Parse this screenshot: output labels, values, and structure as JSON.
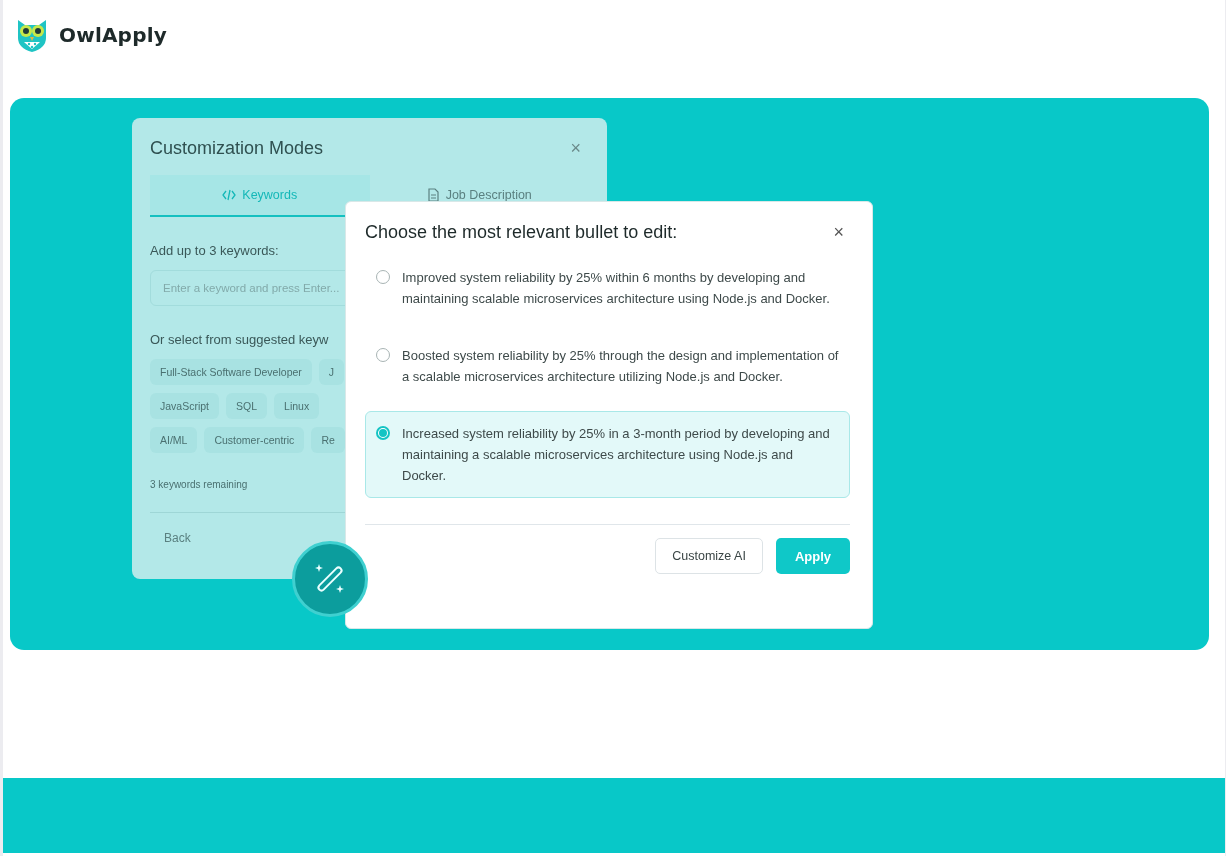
{
  "header": {
    "brand": "OwlApply"
  },
  "customization_dialog": {
    "title": "Customization Modes",
    "close": "×",
    "tabs": [
      {
        "label": "Keywords",
        "selected": true
      },
      {
        "label": "Job Description",
        "selected": false
      }
    ],
    "keywords_label": "Add up to 3 keywords:",
    "keyword_input": {
      "placeholder": "Enter a keyword and press Enter..."
    },
    "suggested_label": "Or select from suggested keyw",
    "suggested_keywords": [
      [
        "Full-Stack Software Developer",
        "J"
      ],
      [
        "JavaScript",
        "SQL",
        "Linux"
      ],
      [
        "AI/ML",
        "Customer-centric",
        "Re"
      ]
    ],
    "remaining": "3 keywords remaining",
    "back": "Back"
  },
  "bullet_dialog": {
    "title": "Choose the most relevant bullet to edit:",
    "close": "×",
    "options": [
      {
        "text": "Improved system reliability by 25% within 6 months by developing and maintaining scalable microservices architecture using Node.js and Docker.",
        "selected": false
      },
      {
        "text": "Boosted system reliability by 25% through the design and implementation of a scalable microservices architecture utilizing Node.js and Docker.",
        "selected": false
      },
      {
        "text": "Increased system reliability by 25% in a 3-month period by developing and maintaining a scalable microservices architecture using Node.js and Docker.",
        "selected": true
      }
    ],
    "buttons": [
      {
        "label": "Customize AI",
        "kind": "secondary"
      },
      {
        "label": "Apply",
        "kind": "primary"
      }
    ]
  }
}
